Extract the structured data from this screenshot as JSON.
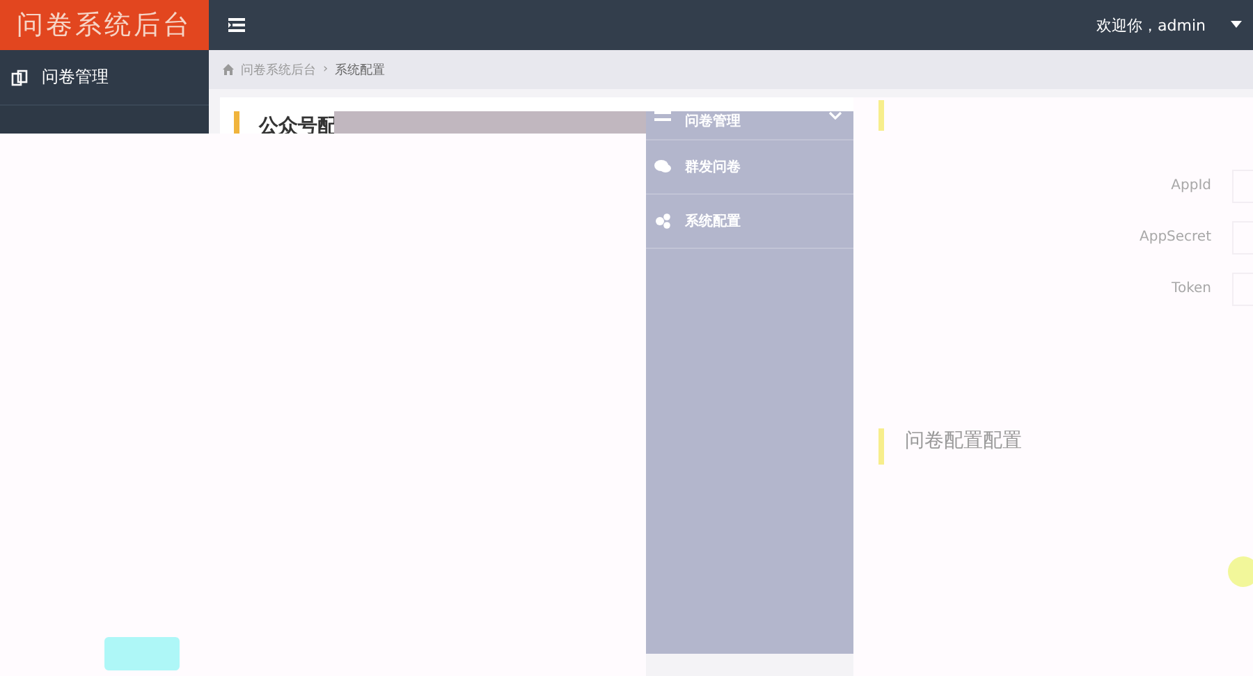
{
  "header": {
    "title": "问卷系统后台",
    "greeting": "欢迎你，admin"
  },
  "sidebar": {
    "items": [
      {
        "label": "问卷管理"
      }
    ]
  },
  "breadcrumb": [
    "问卷系统后台",
    "系统配置"
  ],
  "breadcrumb_separator": "›",
  "card": {
    "title": "公众号配"
  },
  "overlay_menu": {
    "items": [
      {
        "label": "问卷管理",
        "expandable": true
      },
      {
        "label": "群发问卷",
        "expandable": false
      },
      {
        "label": "系统配置",
        "expandable": false
      }
    ]
  },
  "config_panel": {
    "fields": [
      {
        "label": "AppId"
      },
      {
        "label": "AppSecret"
      },
      {
        "label": "Token"
      }
    ],
    "section_title": "问卷配置配置"
  }
}
